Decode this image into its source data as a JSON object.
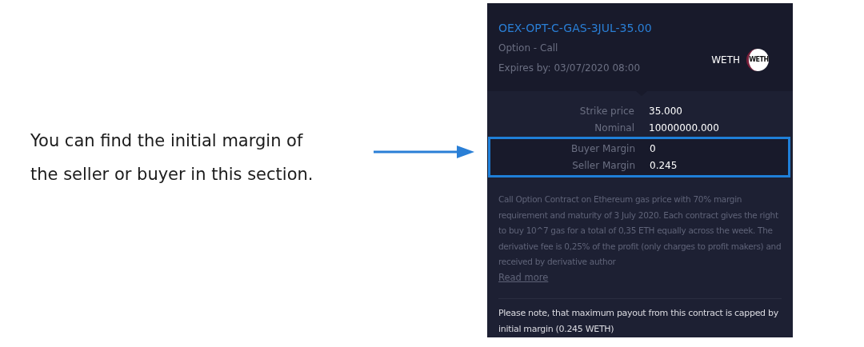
{
  "annotation": {
    "lines": [
      "You can find the initial margin of",
      "the seller or buyer in this section."
    ]
  },
  "card": {
    "title": "OEX-OPT-C-GAS-3JUL-35.00",
    "subtitle": "Option - Call",
    "expires": "Expires by: 03/07/2020 08:00",
    "currency": "WETH",
    "currency_badge": "WETH",
    "details": [
      {
        "label": "Strike price",
        "value": "35.000",
        "highlighted": false
      },
      {
        "label": "Nominal",
        "value": "10000000.000",
        "highlighted": false
      },
      {
        "label": "Buyer Margin",
        "value": "0",
        "highlighted": true
      },
      {
        "label": "Seller Margin",
        "value": "0.245",
        "highlighted": true
      }
    ],
    "description": "Call Option Contract on Ethereum gas price with 70% margin requirement and maturity of 3 July 2020. Each contract gives the right to buy 10^7 gas for a total of 0,35 ETH equally across the week. The derivative fee is 0,25% of the profit (only charges to profit makers) and received by derivative author",
    "read_more": "Read more",
    "note": "Please note, that maximum payout from this contract is capped by initial margin (0.245 WETH)"
  }
}
